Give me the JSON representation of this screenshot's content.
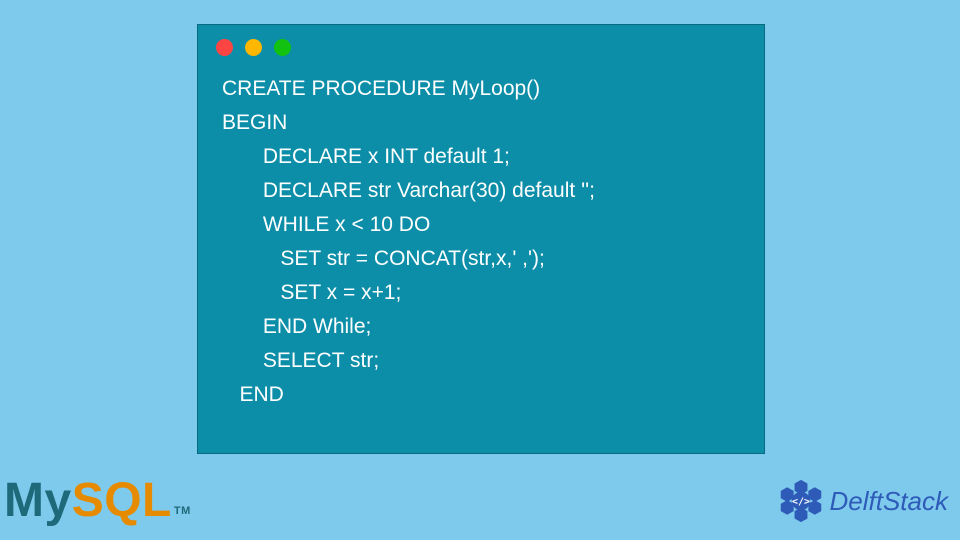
{
  "code": {
    "lines": [
      "CREATE PROCEDURE MyLoop()",
      "BEGIN",
      "       DECLARE x INT default 1;",
      "       DECLARE str Varchar(30) default '';",
      "       WHILE x < 10 DO",
      "          SET str = CONCAT(str,x,' ,');",
      "          SET x = x+1;",
      "       END While;",
      "       SELECT str;",
      "   END"
    ]
  },
  "logos": {
    "mysql": {
      "part1": "My",
      "part2": "SQL",
      "tm": "TM"
    },
    "delftstack": {
      "text": "DelftStack"
    }
  },
  "colors": {
    "page_bg": "#7ecaed",
    "window_bg": "#0c8ea8",
    "code_text": "#ffffff",
    "mysql_my": "#1e6a7a",
    "mysql_sql": "#e68a00",
    "delft_blue": "#2e5bb8"
  }
}
